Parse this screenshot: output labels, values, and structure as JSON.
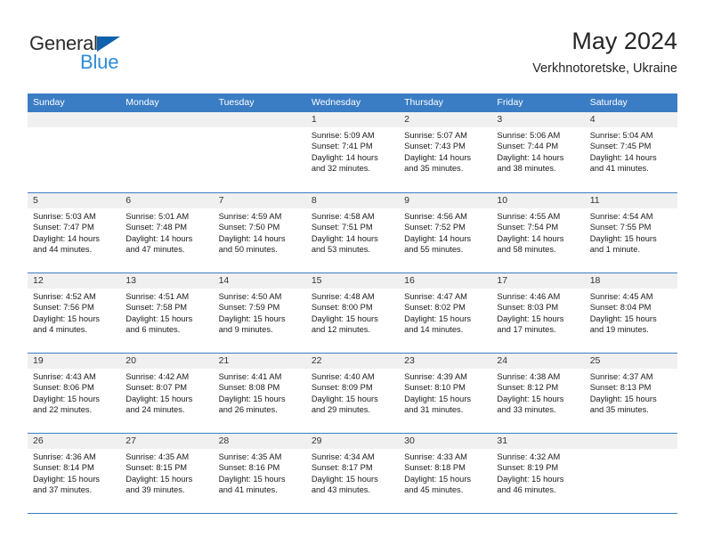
{
  "brand": {
    "name_part1": "General",
    "name_part2": "Blue",
    "triangle_color": "#0e62ad",
    "blue_color": "#2d8bd4"
  },
  "header": {
    "title": "May 2024",
    "subtitle": "Verkhnotoretske, Ukraine",
    "accent_color": "#3b7dc4"
  },
  "weekdays": [
    "Sunday",
    "Monday",
    "Tuesday",
    "Wednesday",
    "Thursday",
    "Friday",
    "Saturday"
  ],
  "labels": {
    "sunrise_prefix": "Sunrise:",
    "sunset_prefix": "Sunset:",
    "daylight_prefix": "Daylight:"
  },
  "weeks": [
    [
      {
        "day": "",
        "empty": true
      },
      {
        "day": "",
        "empty": true
      },
      {
        "day": "",
        "empty": true
      },
      {
        "day": "1",
        "sunrise": "Sunrise: 5:09 AM",
        "sunset": "Sunset: 7:41 PM",
        "daylight_line1": "Daylight: 14 hours",
        "daylight_line2": "and 32 minutes."
      },
      {
        "day": "2",
        "sunrise": "Sunrise: 5:07 AM",
        "sunset": "Sunset: 7:43 PM",
        "daylight_line1": "Daylight: 14 hours",
        "daylight_line2": "and 35 minutes."
      },
      {
        "day": "3",
        "sunrise": "Sunrise: 5:06 AM",
        "sunset": "Sunset: 7:44 PM",
        "daylight_line1": "Daylight: 14 hours",
        "daylight_line2": "and 38 minutes."
      },
      {
        "day": "4",
        "sunrise": "Sunrise: 5:04 AM",
        "sunset": "Sunset: 7:45 PM",
        "daylight_line1": "Daylight: 14 hours",
        "daylight_line2": "and 41 minutes."
      }
    ],
    [
      {
        "day": "5",
        "sunrise": "Sunrise: 5:03 AM",
        "sunset": "Sunset: 7:47 PM",
        "daylight_line1": "Daylight: 14 hours",
        "daylight_line2": "and 44 minutes."
      },
      {
        "day": "6",
        "sunrise": "Sunrise: 5:01 AM",
        "sunset": "Sunset: 7:48 PM",
        "daylight_line1": "Daylight: 14 hours",
        "daylight_line2": "and 47 minutes."
      },
      {
        "day": "7",
        "sunrise": "Sunrise: 4:59 AM",
        "sunset": "Sunset: 7:50 PM",
        "daylight_line1": "Daylight: 14 hours",
        "daylight_line2": "and 50 minutes."
      },
      {
        "day": "8",
        "sunrise": "Sunrise: 4:58 AM",
        "sunset": "Sunset: 7:51 PM",
        "daylight_line1": "Daylight: 14 hours",
        "daylight_line2": "and 53 minutes."
      },
      {
        "day": "9",
        "sunrise": "Sunrise: 4:56 AM",
        "sunset": "Sunset: 7:52 PM",
        "daylight_line1": "Daylight: 14 hours",
        "daylight_line2": "and 55 minutes."
      },
      {
        "day": "10",
        "sunrise": "Sunrise: 4:55 AM",
        "sunset": "Sunset: 7:54 PM",
        "daylight_line1": "Daylight: 14 hours",
        "daylight_line2": "and 58 minutes."
      },
      {
        "day": "11",
        "sunrise": "Sunrise: 4:54 AM",
        "sunset": "Sunset: 7:55 PM",
        "daylight_line1": "Daylight: 15 hours",
        "daylight_line2": "and 1 minute."
      }
    ],
    [
      {
        "day": "12",
        "sunrise": "Sunrise: 4:52 AM",
        "sunset": "Sunset: 7:56 PM",
        "daylight_line1": "Daylight: 15 hours",
        "daylight_line2": "and 4 minutes."
      },
      {
        "day": "13",
        "sunrise": "Sunrise: 4:51 AM",
        "sunset": "Sunset: 7:58 PM",
        "daylight_line1": "Daylight: 15 hours",
        "daylight_line2": "and 6 minutes."
      },
      {
        "day": "14",
        "sunrise": "Sunrise: 4:50 AM",
        "sunset": "Sunset: 7:59 PM",
        "daylight_line1": "Daylight: 15 hours",
        "daylight_line2": "and 9 minutes."
      },
      {
        "day": "15",
        "sunrise": "Sunrise: 4:48 AM",
        "sunset": "Sunset: 8:00 PM",
        "daylight_line1": "Daylight: 15 hours",
        "daylight_line2": "and 12 minutes."
      },
      {
        "day": "16",
        "sunrise": "Sunrise: 4:47 AM",
        "sunset": "Sunset: 8:02 PM",
        "daylight_line1": "Daylight: 15 hours",
        "daylight_line2": "and 14 minutes."
      },
      {
        "day": "17",
        "sunrise": "Sunrise: 4:46 AM",
        "sunset": "Sunset: 8:03 PM",
        "daylight_line1": "Daylight: 15 hours",
        "daylight_line2": "and 17 minutes."
      },
      {
        "day": "18",
        "sunrise": "Sunrise: 4:45 AM",
        "sunset": "Sunset: 8:04 PM",
        "daylight_line1": "Daylight: 15 hours",
        "daylight_line2": "and 19 minutes."
      }
    ],
    [
      {
        "day": "19",
        "sunrise": "Sunrise: 4:43 AM",
        "sunset": "Sunset: 8:06 PM",
        "daylight_line1": "Daylight: 15 hours",
        "daylight_line2": "and 22 minutes."
      },
      {
        "day": "20",
        "sunrise": "Sunrise: 4:42 AM",
        "sunset": "Sunset: 8:07 PM",
        "daylight_line1": "Daylight: 15 hours",
        "daylight_line2": "and 24 minutes."
      },
      {
        "day": "21",
        "sunrise": "Sunrise: 4:41 AM",
        "sunset": "Sunset: 8:08 PM",
        "daylight_line1": "Daylight: 15 hours",
        "daylight_line2": "and 26 minutes."
      },
      {
        "day": "22",
        "sunrise": "Sunrise: 4:40 AM",
        "sunset": "Sunset: 8:09 PM",
        "daylight_line1": "Daylight: 15 hours",
        "daylight_line2": "and 29 minutes."
      },
      {
        "day": "23",
        "sunrise": "Sunrise: 4:39 AM",
        "sunset": "Sunset: 8:10 PM",
        "daylight_line1": "Daylight: 15 hours",
        "daylight_line2": "and 31 minutes."
      },
      {
        "day": "24",
        "sunrise": "Sunrise: 4:38 AM",
        "sunset": "Sunset: 8:12 PM",
        "daylight_line1": "Daylight: 15 hours",
        "daylight_line2": "and 33 minutes."
      },
      {
        "day": "25",
        "sunrise": "Sunrise: 4:37 AM",
        "sunset": "Sunset: 8:13 PM",
        "daylight_line1": "Daylight: 15 hours",
        "daylight_line2": "and 35 minutes."
      }
    ],
    [
      {
        "day": "26",
        "sunrise": "Sunrise: 4:36 AM",
        "sunset": "Sunset: 8:14 PM",
        "daylight_line1": "Daylight: 15 hours",
        "daylight_line2": "and 37 minutes."
      },
      {
        "day": "27",
        "sunrise": "Sunrise: 4:35 AM",
        "sunset": "Sunset: 8:15 PM",
        "daylight_line1": "Daylight: 15 hours",
        "daylight_line2": "and 39 minutes."
      },
      {
        "day": "28",
        "sunrise": "Sunrise: 4:35 AM",
        "sunset": "Sunset: 8:16 PM",
        "daylight_line1": "Daylight: 15 hours",
        "daylight_line2": "and 41 minutes."
      },
      {
        "day": "29",
        "sunrise": "Sunrise: 4:34 AM",
        "sunset": "Sunset: 8:17 PM",
        "daylight_line1": "Daylight: 15 hours",
        "daylight_line2": "and 43 minutes."
      },
      {
        "day": "30",
        "sunrise": "Sunrise: 4:33 AM",
        "sunset": "Sunset: 8:18 PM",
        "daylight_line1": "Daylight: 15 hours",
        "daylight_line2": "and 45 minutes."
      },
      {
        "day": "31",
        "sunrise": "Sunrise: 4:32 AM",
        "sunset": "Sunset: 8:19 PM",
        "daylight_line1": "Daylight: 15 hours",
        "daylight_line2": "and 46 minutes."
      },
      {
        "day": "",
        "empty": true
      }
    ]
  ]
}
